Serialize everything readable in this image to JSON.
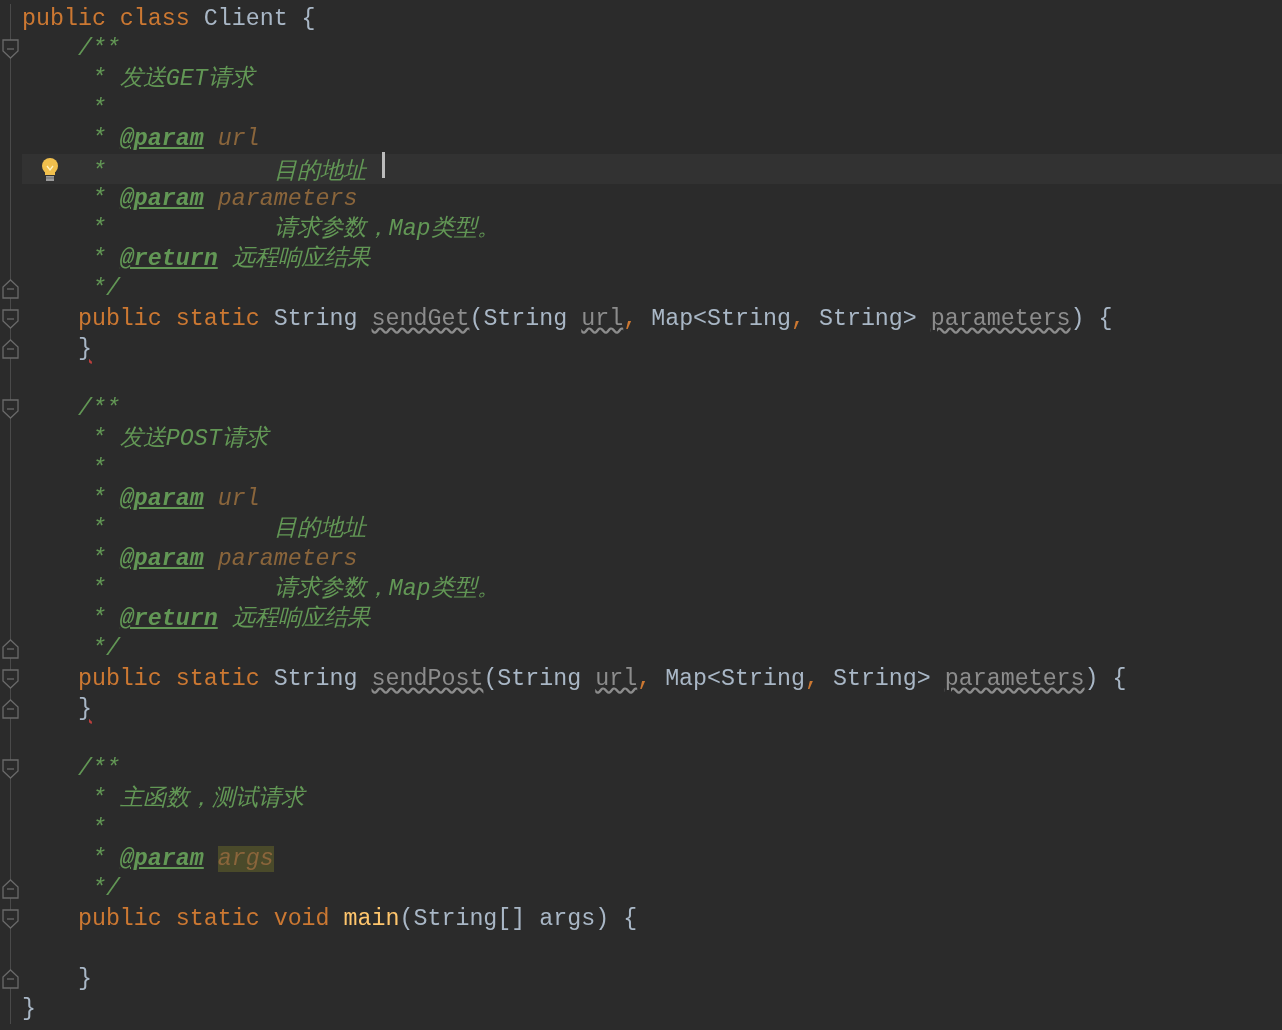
{
  "editor": {
    "lines": [
      {
        "fold_start": false,
        "fold_end": false,
        "current": false,
        "bulb": false,
        "caret": false,
        "tokens": [
          {
            "kind": "kw",
            "text": "public class "
          },
          {
            "kind": "plain",
            "text": "Client {"
          }
        ]
      },
      {
        "fold_start": true,
        "fold_end": false,
        "current": false,
        "bulb": false,
        "caret": false,
        "tokens": [
          {
            "kind": "doc",
            "text": "    /**"
          }
        ]
      },
      {
        "fold_start": false,
        "fold_end": false,
        "current": false,
        "bulb": false,
        "caret": false,
        "tokens": [
          {
            "kind": "doc",
            "text": "     * 发送GET请求"
          }
        ]
      },
      {
        "fold_start": false,
        "fold_end": false,
        "current": false,
        "bulb": false,
        "caret": false,
        "tokens": [
          {
            "kind": "doc",
            "text": "     *"
          }
        ]
      },
      {
        "fold_start": false,
        "fold_end": false,
        "current": false,
        "bulb": false,
        "caret": false,
        "tokens": [
          {
            "kind": "doc",
            "text": "     * "
          },
          {
            "kind": "tag",
            "text": "@param"
          },
          {
            "kind": "param",
            "text": " url"
          }
        ]
      },
      {
        "fold_start": false,
        "fold_end": false,
        "current": true,
        "bulb": true,
        "caret": true,
        "tokens": [
          {
            "kind": "doc",
            "text": "     *            目的地址 "
          }
        ]
      },
      {
        "fold_start": false,
        "fold_end": false,
        "current": false,
        "bulb": false,
        "caret": false,
        "tokens": [
          {
            "kind": "doc",
            "text": "     * "
          },
          {
            "kind": "tag",
            "text": "@param"
          },
          {
            "kind": "param",
            "text": " parameters"
          }
        ]
      },
      {
        "fold_start": false,
        "fold_end": false,
        "current": false,
        "bulb": false,
        "caret": false,
        "tokens": [
          {
            "kind": "doc",
            "text": "     *            请求参数，Map类型。"
          }
        ]
      },
      {
        "fold_start": false,
        "fold_end": false,
        "current": false,
        "bulb": false,
        "caret": false,
        "tokens": [
          {
            "kind": "doc",
            "text": "     * "
          },
          {
            "kind": "tag",
            "text": "@return"
          },
          {
            "kind": "doc",
            "text": " 远程响应结果"
          }
        ]
      },
      {
        "fold_start": false,
        "fold_end": true,
        "current": false,
        "bulb": false,
        "caret": false,
        "tokens": [
          {
            "kind": "doc",
            "text": "     */"
          }
        ]
      },
      {
        "fold_start": true,
        "fold_end": false,
        "current": false,
        "bulb": false,
        "caret": false,
        "tokens": [
          {
            "kind": "kw",
            "text": "    public static "
          },
          {
            "kind": "plain",
            "text": "String "
          },
          {
            "kind": "unused",
            "text": "sendGet"
          },
          {
            "kind": "plain",
            "text": "(String "
          },
          {
            "kind": "unused",
            "text": "url"
          },
          {
            "kind": "kw",
            "text": ", "
          },
          {
            "kind": "plain",
            "text": "Map<String"
          },
          {
            "kind": "kw",
            "text": ", "
          },
          {
            "kind": "plain",
            "text": "String> "
          },
          {
            "kind": "unused",
            "text": "parameters"
          },
          {
            "kind": "plain",
            "text": ") {"
          }
        ]
      },
      {
        "fold_start": false,
        "fold_end": true,
        "current": false,
        "bulb": false,
        "caret": false,
        "tokens": [
          {
            "kind": "error",
            "text": "    }"
          }
        ]
      },
      {
        "fold_start": false,
        "fold_end": false,
        "current": false,
        "bulb": false,
        "caret": false
      },
      {
        "fold_start": true,
        "fold_end": false,
        "current": false,
        "bulb": false,
        "caret": false,
        "tokens": [
          {
            "kind": "doc",
            "text": "    /**"
          }
        ]
      },
      {
        "fold_start": false,
        "fold_end": false,
        "current": false,
        "bulb": false,
        "caret": false,
        "tokens": [
          {
            "kind": "doc",
            "text": "     * 发送POST请求"
          }
        ]
      },
      {
        "fold_start": false,
        "fold_end": false,
        "current": false,
        "bulb": false,
        "caret": false,
        "tokens": [
          {
            "kind": "doc",
            "text": "     *"
          }
        ]
      },
      {
        "fold_start": false,
        "fold_end": false,
        "current": false,
        "bulb": false,
        "caret": false,
        "tokens": [
          {
            "kind": "doc",
            "text": "     * "
          },
          {
            "kind": "tag",
            "text": "@param"
          },
          {
            "kind": "param",
            "text": " url"
          }
        ]
      },
      {
        "fold_start": false,
        "fold_end": false,
        "current": false,
        "bulb": false,
        "caret": false,
        "tokens": [
          {
            "kind": "doc",
            "text": "     *            目的地址"
          }
        ]
      },
      {
        "fold_start": false,
        "fold_end": false,
        "current": false,
        "bulb": false,
        "caret": false,
        "tokens": [
          {
            "kind": "doc",
            "text": "     * "
          },
          {
            "kind": "tag",
            "text": "@param"
          },
          {
            "kind": "param",
            "text": " parameters"
          }
        ]
      },
      {
        "fold_start": false,
        "fold_end": false,
        "current": false,
        "bulb": false,
        "caret": false,
        "tokens": [
          {
            "kind": "doc",
            "text": "     *            请求参数，Map类型。"
          }
        ]
      },
      {
        "fold_start": false,
        "fold_end": false,
        "current": false,
        "bulb": false,
        "caret": false,
        "tokens": [
          {
            "kind": "doc",
            "text": "     * "
          },
          {
            "kind": "tag",
            "text": "@return"
          },
          {
            "kind": "doc",
            "text": " 远程响应结果"
          }
        ]
      },
      {
        "fold_start": false,
        "fold_end": true,
        "current": false,
        "bulb": false,
        "caret": false,
        "tokens": [
          {
            "kind": "doc",
            "text": "     */"
          }
        ]
      },
      {
        "fold_start": true,
        "fold_end": false,
        "current": false,
        "bulb": false,
        "caret": false,
        "tokens": [
          {
            "kind": "kw",
            "text": "    public static "
          },
          {
            "kind": "plain",
            "text": "String "
          },
          {
            "kind": "unused",
            "text": "sendPost"
          },
          {
            "kind": "plain",
            "text": "(String "
          },
          {
            "kind": "unused",
            "text": "url"
          },
          {
            "kind": "kw",
            "text": ", "
          },
          {
            "kind": "plain",
            "text": "Map<String"
          },
          {
            "kind": "kw",
            "text": ", "
          },
          {
            "kind": "plain",
            "text": "String> "
          },
          {
            "kind": "unused",
            "text": "parameters"
          },
          {
            "kind": "plain",
            "text": ") {"
          }
        ]
      },
      {
        "fold_start": false,
        "fold_end": true,
        "current": false,
        "bulb": false,
        "caret": false,
        "tokens": [
          {
            "kind": "error",
            "text": "    }"
          }
        ]
      },
      {
        "fold_start": false,
        "fold_end": false,
        "current": false,
        "bulb": false,
        "caret": false
      },
      {
        "fold_start": true,
        "fold_end": false,
        "current": false,
        "bulb": false,
        "caret": false,
        "tokens": [
          {
            "kind": "doc",
            "text": "    /**"
          }
        ]
      },
      {
        "fold_start": false,
        "fold_end": false,
        "current": false,
        "bulb": false,
        "caret": false,
        "tokens": [
          {
            "kind": "doc",
            "text": "     * 主函数，测试请求"
          }
        ]
      },
      {
        "fold_start": false,
        "fold_end": false,
        "current": false,
        "bulb": false,
        "caret": false,
        "tokens": [
          {
            "kind": "doc",
            "text": "     *"
          }
        ]
      },
      {
        "fold_start": false,
        "fold_end": false,
        "current": false,
        "bulb": false,
        "caret": false,
        "tokens": [
          {
            "kind": "doc",
            "text": "     * "
          },
          {
            "kind": "tag",
            "text": "@param"
          },
          {
            "kind": "marked",
            "text": " args"
          }
        ]
      },
      {
        "fold_start": false,
        "fold_end": true,
        "current": false,
        "bulb": false,
        "caret": false,
        "tokens": [
          {
            "kind": "doc",
            "text": "     */"
          }
        ]
      },
      {
        "fold_start": true,
        "fold_end": false,
        "current": false,
        "bulb": false,
        "caret": false,
        "tokens": [
          {
            "kind": "kw",
            "text": "    public static void "
          },
          {
            "kind": "fn",
            "text": "main"
          },
          {
            "kind": "plain",
            "text": "(String[] args) {"
          }
        ]
      },
      {
        "fold_start": false,
        "fold_end": false,
        "current": false,
        "bulb": false,
        "caret": false
      },
      {
        "fold_start": false,
        "fold_end": true,
        "current": false,
        "bulb": false,
        "caret": false,
        "tokens": [
          {
            "kind": "plain",
            "text": "    }"
          }
        ]
      },
      {
        "fold_start": false,
        "fold_end": false,
        "current": false,
        "bulb": false,
        "caret": false,
        "tokens": [
          {
            "kind": "plain",
            "text": "}"
          }
        ]
      }
    ]
  }
}
